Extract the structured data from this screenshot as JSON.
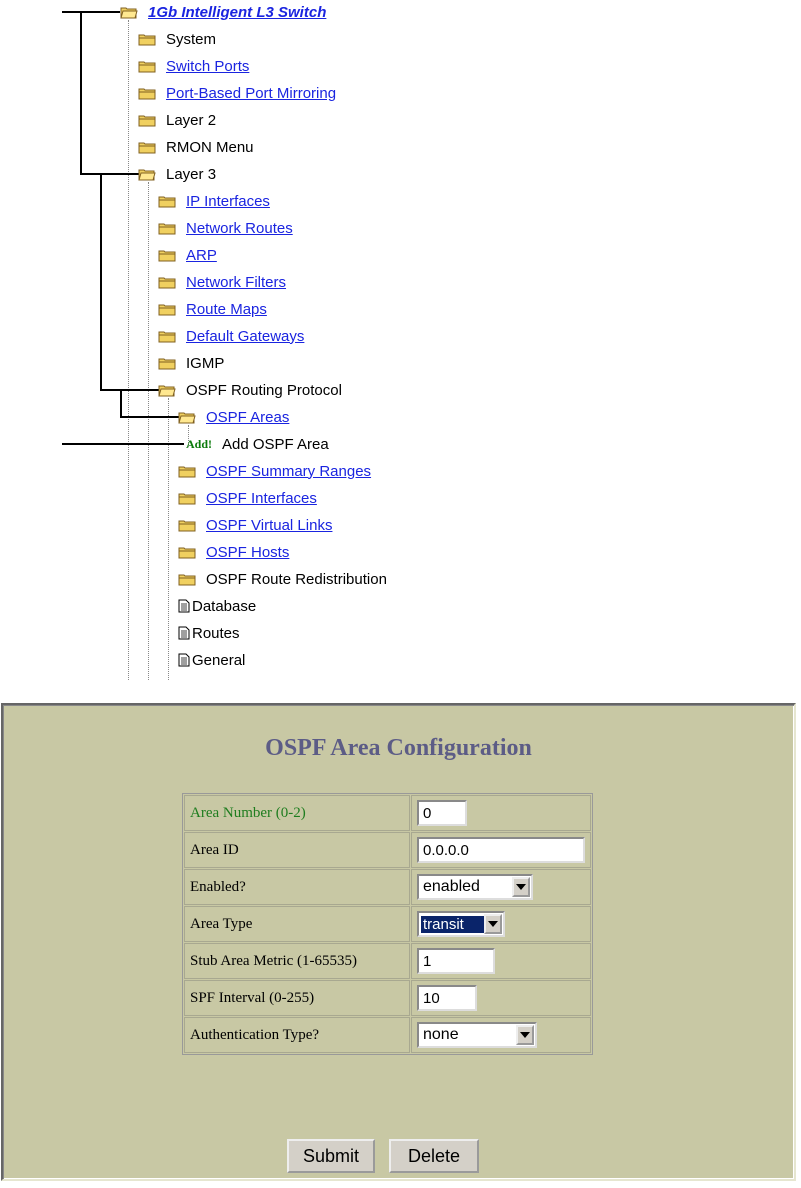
{
  "tree": {
    "root": "1Gb Intelligent L3 Switch",
    "level1": [
      "System",
      "Switch Ports",
      "Port-Based Port Mirroring",
      "Layer 2",
      "RMON Menu",
      "Layer 3"
    ],
    "layer3_children": [
      "IP Interfaces",
      "Network Routes",
      "ARP",
      "Network Filters",
      "Route Maps",
      "Default Gateways",
      "IGMP",
      "OSPF Routing Protocol"
    ],
    "ospf_areas": "OSPF Areas",
    "add_badge": "Add!",
    "add_area": "Add OSPF Area",
    "ospf_children": [
      "OSPF Summary Ranges",
      "OSPF Interfaces",
      "OSPF Virtual Links",
      "OSPF Hosts",
      "OSPF Route Redistribution"
    ],
    "documents": [
      "Database",
      "Routes",
      "General"
    ]
  },
  "form": {
    "title": "OSPF Area Configuration",
    "fields": {
      "area_number": {
        "label": "Area Number (0-2)",
        "value": "0"
      },
      "area_id": {
        "label": "Area ID",
        "value": "0.0.0.0"
      },
      "enabled": {
        "label": "Enabled?",
        "value": "enabled"
      },
      "area_type": {
        "label": "Area Type",
        "value": "transit"
      },
      "stub_metric": {
        "label": "Stub Area Metric (1-65535)",
        "value": "1"
      },
      "spf_interval": {
        "label": "SPF Interval (0-255)",
        "value": "10"
      },
      "auth_type": {
        "label": "Authentication Type?",
        "value": "none"
      }
    },
    "buttons": {
      "submit": "Submit",
      "delete": "Delete"
    }
  },
  "colors": {
    "panel_bg": "#c8c8a4",
    "title": "#5c5c86",
    "link": "#1a24e0",
    "highlight": "#0a246a",
    "add_badge": "#0a7a0a"
  }
}
